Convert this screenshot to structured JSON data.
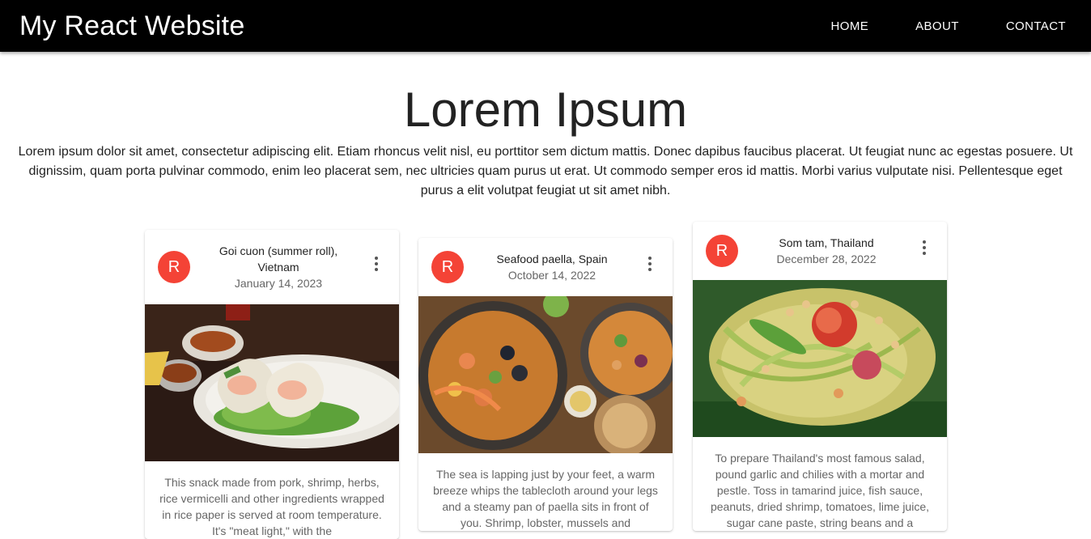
{
  "appbar": {
    "title": "My React Website",
    "nav": [
      "HOME",
      "ABOUT",
      "CONTACT"
    ]
  },
  "hero": {
    "title": "Lorem Ipsum",
    "text": "Lorem ipsum dolor sit amet, consectetur adipiscing elit. Etiam rhoncus velit nisl, eu porttitor sem dictum mattis. Donec dapibus faucibus placerat. Ut feugiat nunc ac egestas posuere. Ut dignissim, quam porta pulvinar commodo, enim leo placerat sem, nec ultricies quam purus ut erat. Ut commodo semper eros id mattis. Morbi varius vulputate nisi. Pellentesque eget purus a elit volutpat feugiat ut sit amet nibh."
  },
  "cards": [
    {
      "avatar": "R",
      "title": "Goi cuon (summer roll), Vietnam",
      "date": "January 14, 2023",
      "text": "This snack made from pork, shrimp, herbs, rice vermicelli and other ingredients wrapped in rice paper is served at room temperature. It's \"meat light,\" with the"
    },
    {
      "avatar": "R",
      "title": "Seafood paella, Spain",
      "date": "October 14, 2022",
      "text": "The sea is lapping just by your feet, a warm breeze whips the tablecloth around your legs and a steamy pan of paella sits in front of you. Shrimp, lobster, mussels and"
    },
    {
      "avatar": "R",
      "title": "Som tam, Thailand",
      "date": "December 28, 2022",
      "text": "To prepare Thailand's most famous salad, pound garlic and chilies with a mortar and pestle. Toss in tamarind juice, fish sauce, peanuts, dried shrimp, tomatoes, lime juice, sugar cane paste, string beans and a"
    }
  ],
  "colors": {
    "appbar": "#000000",
    "avatar": "#f44336"
  },
  "icons": {
    "card_menu": "more-vert-icon"
  }
}
